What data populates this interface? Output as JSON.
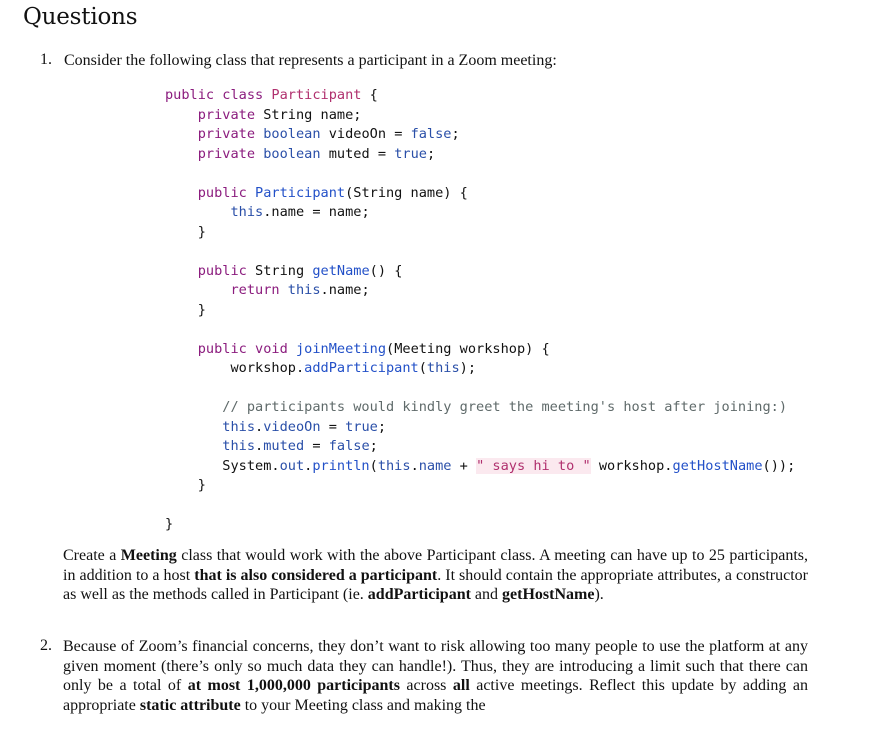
{
  "heading": "Questions",
  "q1": {
    "number": "1.",
    "intro": "Consider the following class that represents a participant in a Zoom meeting:",
    "code_lines": [
      "public class Participant {",
      "    private String name;",
      "    private boolean videoOn = false;",
      "    private boolean muted = true;",
      "",
      "    public Participant(String name) {",
      "        this.name = name;",
      "    }",
      "",
      "    public String getName() {",
      "        return this.name;",
      "    }",
      "",
      "    public void joinMeeting(Meeting workshop) {",
      "        workshop.addParticipant(this);",
      "",
      "        // participants would kindly greet the meeting's host after joining:)",
      "        this.videoOn = true;",
      "        this.muted = false;",
      "        System.out.println(this.name + \" says hi to \" workshop.getHostName());",
      "    }",
      "",
      "}"
    ],
    "para": {
      "t1": "Create a ",
      "b1": "Meeting",
      "t2": " class that would work with the above Participant class. A meeting can have up to 25 participants, in addition to a host ",
      "b2": "that is also considered a participant",
      "t3": ". It should contain the appropriate attributes, a constructor as well as the methods called in Participant (ie. ",
      "b3": "addParticipant",
      "t4": " and ",
      "b4": "getHostName",
      "t5": ")."
    }
  },
  "q2": {
    "number": "2.",
    "para": {
      "t1": "Because of Zoom’s financial concerns, they don’t want to risk allowing too many people to use the platform at any given moment (there’s only so much data they can handle!). Thus, they are introducing a limit such that there can only be a total of ",
      "b1": "at most 1,000,000 participants",
      "t2": " across ",
      "b2": "all",
      "t3": " active meetings. Reflect this update by adding an appropriate ",
      "b3": "static attribute",
      "t4": " to your Meeting class and making the"
    }
  }
}
